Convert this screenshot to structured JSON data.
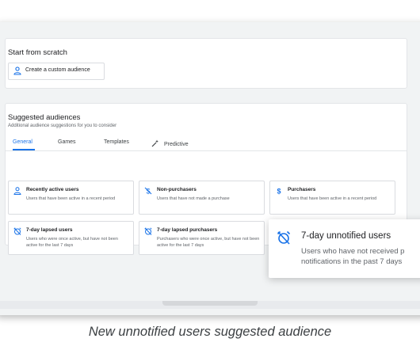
{
  "scratch": {
    "title": "Start from scratch",
    "create_button_label": "Create a custom audience",
    "create_icon": "person-icon"
  },
  "suggested": {
    "title": "Suggested audiences",
    "subtitle": "Additional audience suggestions for you to consider",
    "tabs": [
      {
        "label": "General",
        "active": true
      },
      {
        "label": "Games",
        "active": false
      },
      {
        "label": "Templates",
        "active": false
      },
      {
        "label": "Predictive",
        "active": false,
        "icon": "magic-wand-icon"
      }
    ],
    "tiles": [
      {
        "title": "Recently active users",
        "description": "Users that have been active in a recent period",
        "icon": "person-icon"
      },
      {
        "title": "Non-purchasers",
        "description": "Users that have not made a purchase",
        "icon": "no-money-icon"
      },
      {
        "title": "Purchasers",
        "description": "Users that have been active in a recent period",
        "icon": "dollar-icon"
      },
      {
        "title": "7-day lapsed users",
        "description": "Users who were once active, but have not been active for the last 7 days",
        "icon": "alarm-off-icon"
      },
      {
        "title": "7-day lapsed purchasers",
        "description": "Purchasers who were once active, but have not been active for the last 7 days",
        "icon": "alarm-off-icon"
      }
    ]
  },
  "popup": {
    "title": "7-day unnotified users",
    "description_line1": "Users who have not received p",
    "description_line2": "notifications in the past 7 days",
    "icon": "alarm-off-icon"
  },
  "caption": "New unnotified users suggested audience",
  "colors": {
    "accent": "#1a73e8",
    "background": "#f1f3f4",
    "text_secondary": "#5f6368"
  }
}
